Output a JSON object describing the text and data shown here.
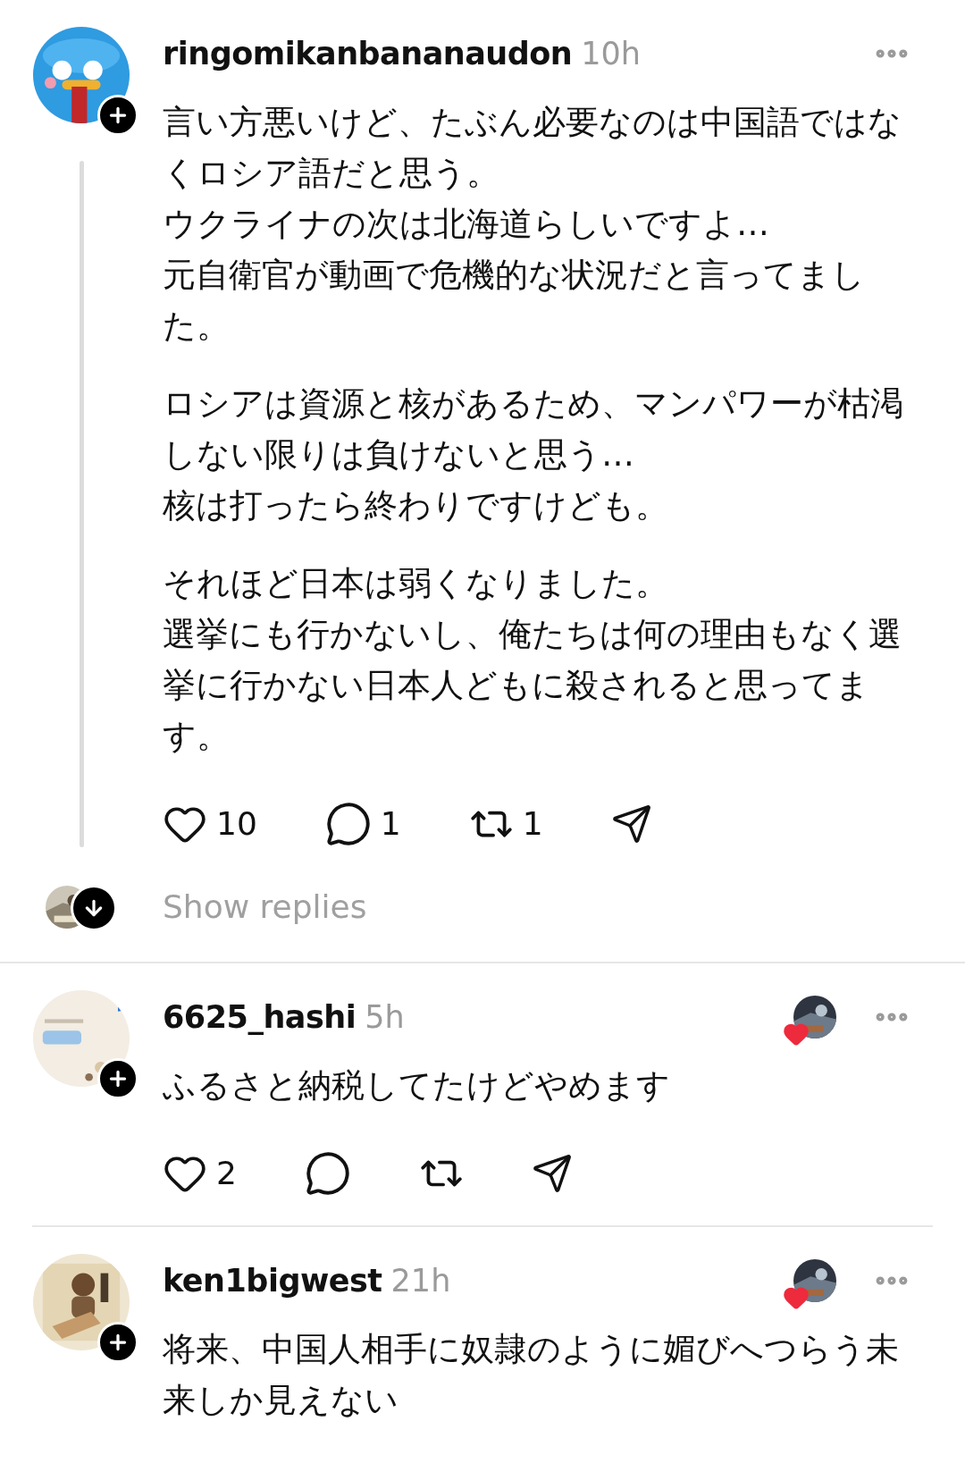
{
  "posts": [
    {
      "username": "ringomikanbananaudon",
      "time": "10h",
      "author_liked": false,
      "paragraphs": [
        [
          "言い方悪いけど、たぶん必要なのは中国語ではなくロシア語だと思う。",
          "ウクライナの次は北海道らしいですよ…",
          "元自衛官が動画で危機的な状況だと言ってました。"
        ],
        [
          "ロシアは資源と核があるため、マンパワーが枯渇しない限りは負けないと思う…",
          "核は打ったら終わりですけども。"
        ],
        [
          "それほど日本は弱くなりました。",
          "選挙にも行かないし、俺たちは何の理由もなく選挙に行かない日本人どもに殺されると思ってます。"
        ]
      ],
      "actions": {
        "likes": "10",
        "replies": "1",
        "reposts": "1"
      },
      "show_replies": "Show replies"
    },
    {
      "username": "6625_hashi",
      "time": "5h",
      "author_liked": true,
      "paragraphs": [
        [
          "ふるさと納税してたけどやめます"
        ]
      ],
      "actions": {
        "likes": "2"
      }
    },
    {
      "username": "ken1bigwest",
      "time": "21h",
      "author_liked": true,
      "paragraphs": [
        [
          "将来、中国人相手に奴隷のように媚びへつらう未来しか見えない"
        ]
      ]
    }
  ]
}
